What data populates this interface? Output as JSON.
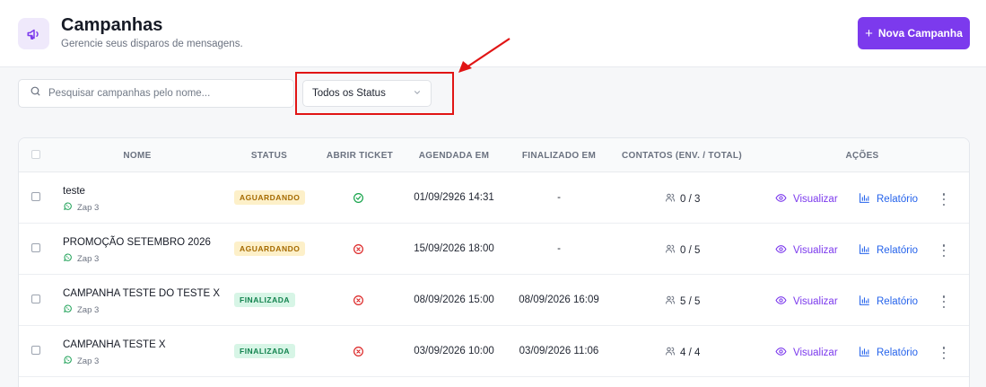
{
  "header": {
    "title": "Campanhas",
    "subtitle": "Gerencie seus disparos de mensagens.",
    "icon": "megaphone-icon",
    "new_button_label": "Nova Campanha"
  },
  "filters": {
    "search_placeholder": "Pesquisar campanhas pelo nome...",
    "status_select_value": "Todos os Status"
  },
  "colors": {
    "accent": "#7c3aed",
    "link_blue": "#2563eb",
    "annotation_red": "#e11515"
  },
  "table": {
    "columns": [
      "NOME",
      "STATUS",
      "ABRIR TICKET",
      "AGENDADA EM",
      "FINALIZADO EM",
      "CONTATOS (ENV. / TOTAL)",
      "AÇÕES"
    ],
    "rows": [
      {
        "name": "teste",
        "connection": "Zap 3",
        "status": "AGUARDANDO",
        "status_kind": "waiting",
        "open_ticket": "yes",
        "scheduled": "01/09/2926 14:31",
        "finished": "-",
        "contacts": "0 / 3",
        "view": "Visualizar",
        "report": "Relatório"
      },
      {
        "name": "PROMOÇÃO SETEMBRO 2026",
        "connection": "Zap 3",
        "status": "AGUARDANDO",
        "status_kind": "waiting",
        "open_ticket": "no",
        "scheduled": "15/09/2026 18:00",
        "finished": "-",
        "contacts": "0 / 5",
        "view": "Visualizar",
        "report": "Relatório"
      },
      {
        "name": "CAMPANHA TESTE DO TESTE X",
        "connection": "Zap 3",
        "status": "FINALIZADA",
        "status_kind": "done",
        "open_ticket": "no",
        "scheduled": "08/09/2026 15:00",
        "finished": "08/09/2026 16:09",
        "contacts": "5 / 5",
        "view": "Visualizar",
        "report": "Relatório"
      },
      {
        "name": "CAMPANHA TESTE X",
        "connection": "Zap 3",
        "status": "FINALIZADA",
        "status_kind": "done",
        "open_ticket": "no",
        "scheduled": "03/09/2026 10:00",
        "finished": "03/09/2026 11:06",
        "contacts": "4 / 4",
        "view": "Visualizar",
        "report": "Relatório"
      }
    ]
  }
}
